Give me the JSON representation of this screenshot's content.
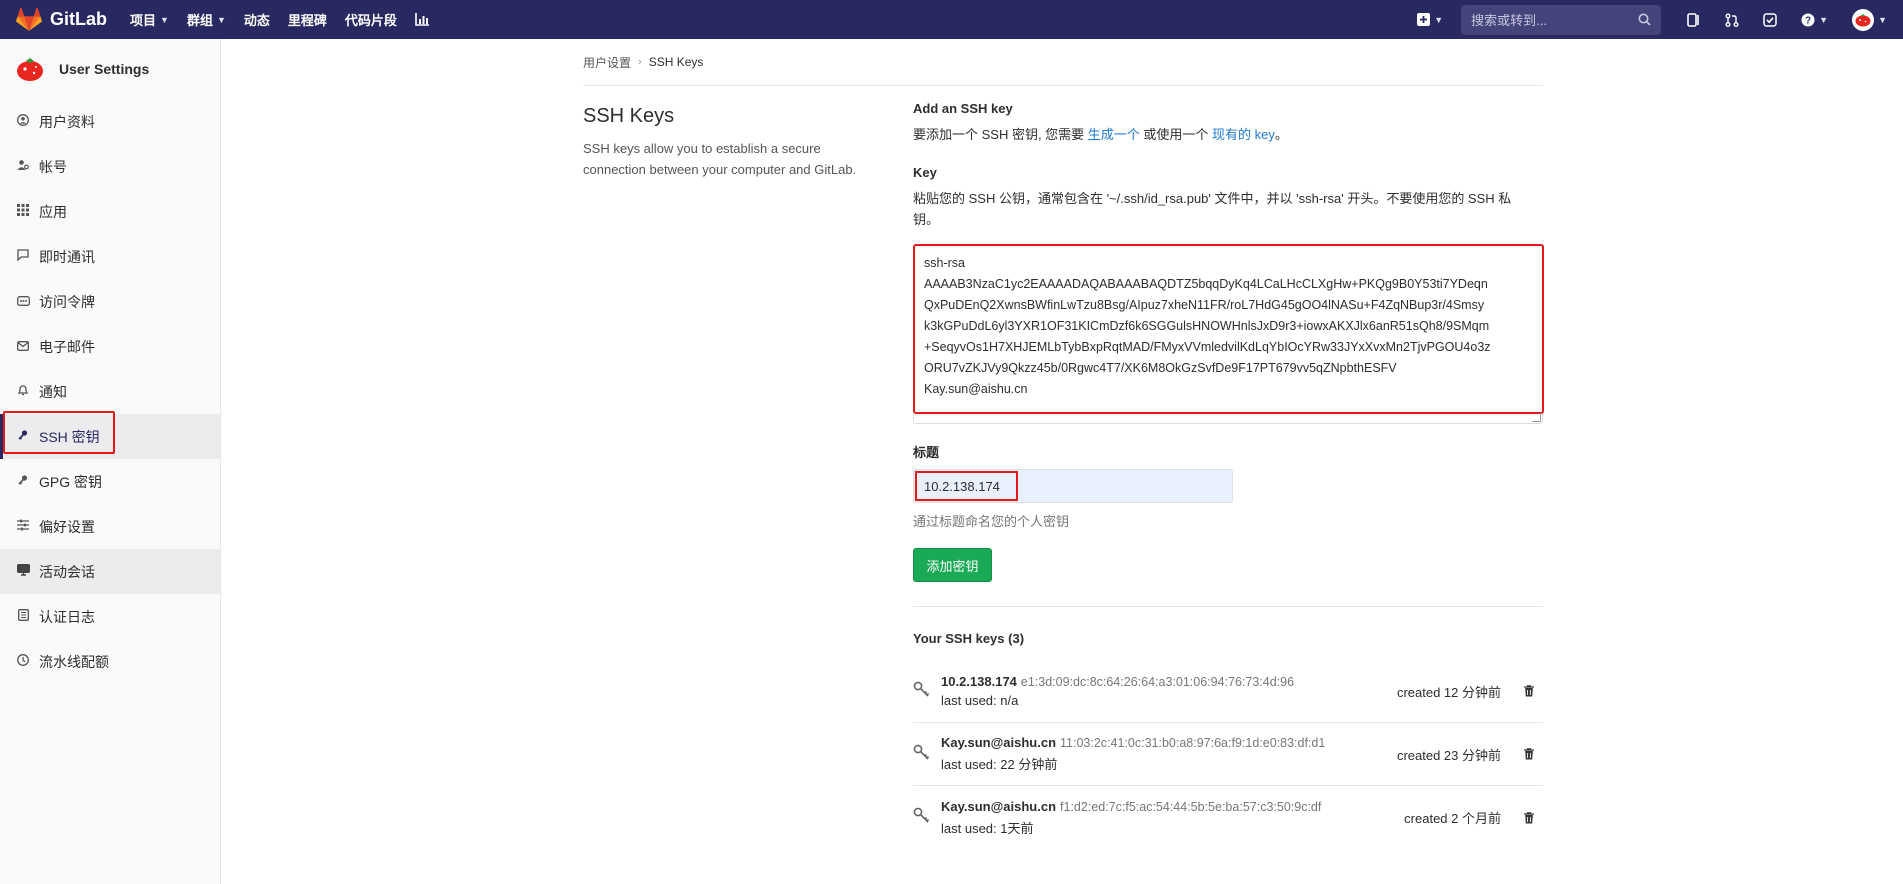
{
  "navbar": {
    "brand": "GitLab",
    "items": [
      {
        "label": "项目",
        "has_dropdown": true
      },
      {
        "label": "群组",
        "has_dropdown": true
      },
      {
        "label": "动态",
        "has_dropdown": false
      },
      {
        "label": "里程碑",
        "has_dropdown": false
      },
      {
        "label": "代码片段",
        "has_dropdown": false
      }
    ],
    "search_placeholder": "搜索或转到...",
    "brand_color": "#292961"
  },
  "sidebar": {
    "title": "User Settings",
    "items": [
      {
        "label": "用户资料",
        "icon": "profile-icon"
      },
      {
        "label": "帐号",
        "icon": "account-icon"
      },
      {
        "label": "应用",
        "icon": "applications-icon"
      },
      {
        "label": "即时通讯",
        "icon": "chat-icon"
      },
      {
        "label": "访问令牌",
        "icon": "token-icon"
      },
      {
        "label": "电子邮件",
        "icon": "email-icon"
      },
      {
        "label": "通知",
        "icon": "notification-icon"
      },
      {
        "label": "SSH 密钥",
        "icon": "key-icon",
        "active": true
      },
      {
        "label": "GPG 密钥",
        "icon": "key-icon"
      },
      {
        "label": "偏好设置",
        "icon": "preferences-icon"
      },
      {
        "label": "活动会话",
        "icon": "session-icon"
      },
      {
        "label": "认证日志",
        "icon": "log-icon"
      },
      {
        "label": "流水线配额",
        "icon": "quota-icon"
      }
    ]
  },
  "breadcrumb": {
    "parent": "用户设置",
    "current": "SSH Keys"
  },
  "page": {
    "heading": "SSH Keys",
    "description": "SSH keys allow you to establish a secure connection between your computer and GitLab."
  },
  "form": {
    "add_title": "Add an SSH key",
    "add_text_prefix": "要添加一个 SSH 密钥, 您需要 ",
    "add_link_generate": "生成一个",
    "add_text_middle": " 或使用一个 ",
    "add_link_existing": "现有的 key",
    "add_text_suffix": "。",
    "key_label": "Key",
    "key_help": "粘贴您的 SSH 公钥，通常包含在 '~/.ssh/id_rsa.pub' 文件中，并以 'ssh-rsa' 开头。不要使用您的 SSH 私钥。",
    "key_lines": [
      "ssh-rsa",
      "AAAAB3NzaC1yc2EAAAADAQABAAABAQDTZ5bqqDyKq4LCaLHcCLXgHw+PKQg9B0Y53ti7YDeqn",
      "QxPuDEnQ2XwnsBWfinLwTzu8Bsg/AIpuz7xheN11FR/roL7HdG45gOO4lNASu+F4ZqNBup3r/4Smsy",
      "k3kGPuDdL6yl3YXR1OF31KICmDzf6k6SGGulsHNOWHnlsJxD9r3+iowxAKXJlx6anR51sQh8/9SMqm",
      "+SeqyvOs1H7XHJEMLbTybBxpRqtMAD/FMyxVVmledvilKdLqYbIOcYRw33JYxXvxMn2TjvPGOU4o3z",
      "ORU7vZKJVy9Qkzz45b/0Rgwc4T7/XK6M8OkGzSvfDe9F17PT679vv5qZNpbthESFV",
      "Kay.sun@aishu.cn"
    ],
    "title_label": "标题",
    "title_value": "10.2.138.174",
    "title_help": "通过标题命名您的个人密钥",
    "submit_label": "添加密钥"
  },
  "keys": {
    "title": "Your SSH keys (3)",
    "items": [
      {
        "name": "10.2.138.174",
        "fingerprint": "e1:3d:09:dc:8c:64:26:64:a3:01:06:94:76:73:4d:96",
        "last_used": "last used: n/a",
        "created": "created 12 分钟前"
      },
      {
        "name": "Kay.sun@aishu.cn",
        "fingerprint": "11:03:2c:41:0c:31:b0:a8:97:6a:f9:1d:e0:83:df:d1",
        "last_used": "last used: 22 分钟前",
        "created": "created 23 分钟前"
      },
      {
        "name": "Kay.sun@aishu.cn",
        "fingerprint": "f1:d2:ed:7c:f5:ac:54:44:5b:5e:ba:57:c3:50:9c:df",
        "last_used": "last used: 1天前",
        "created": "created 2 个月前"
      }
    ]
  },
  "colors": {
    "accent": "#1aaa55",
    "link": "#1f78d1",
    "highlight": "#e3191c"
  }
}
